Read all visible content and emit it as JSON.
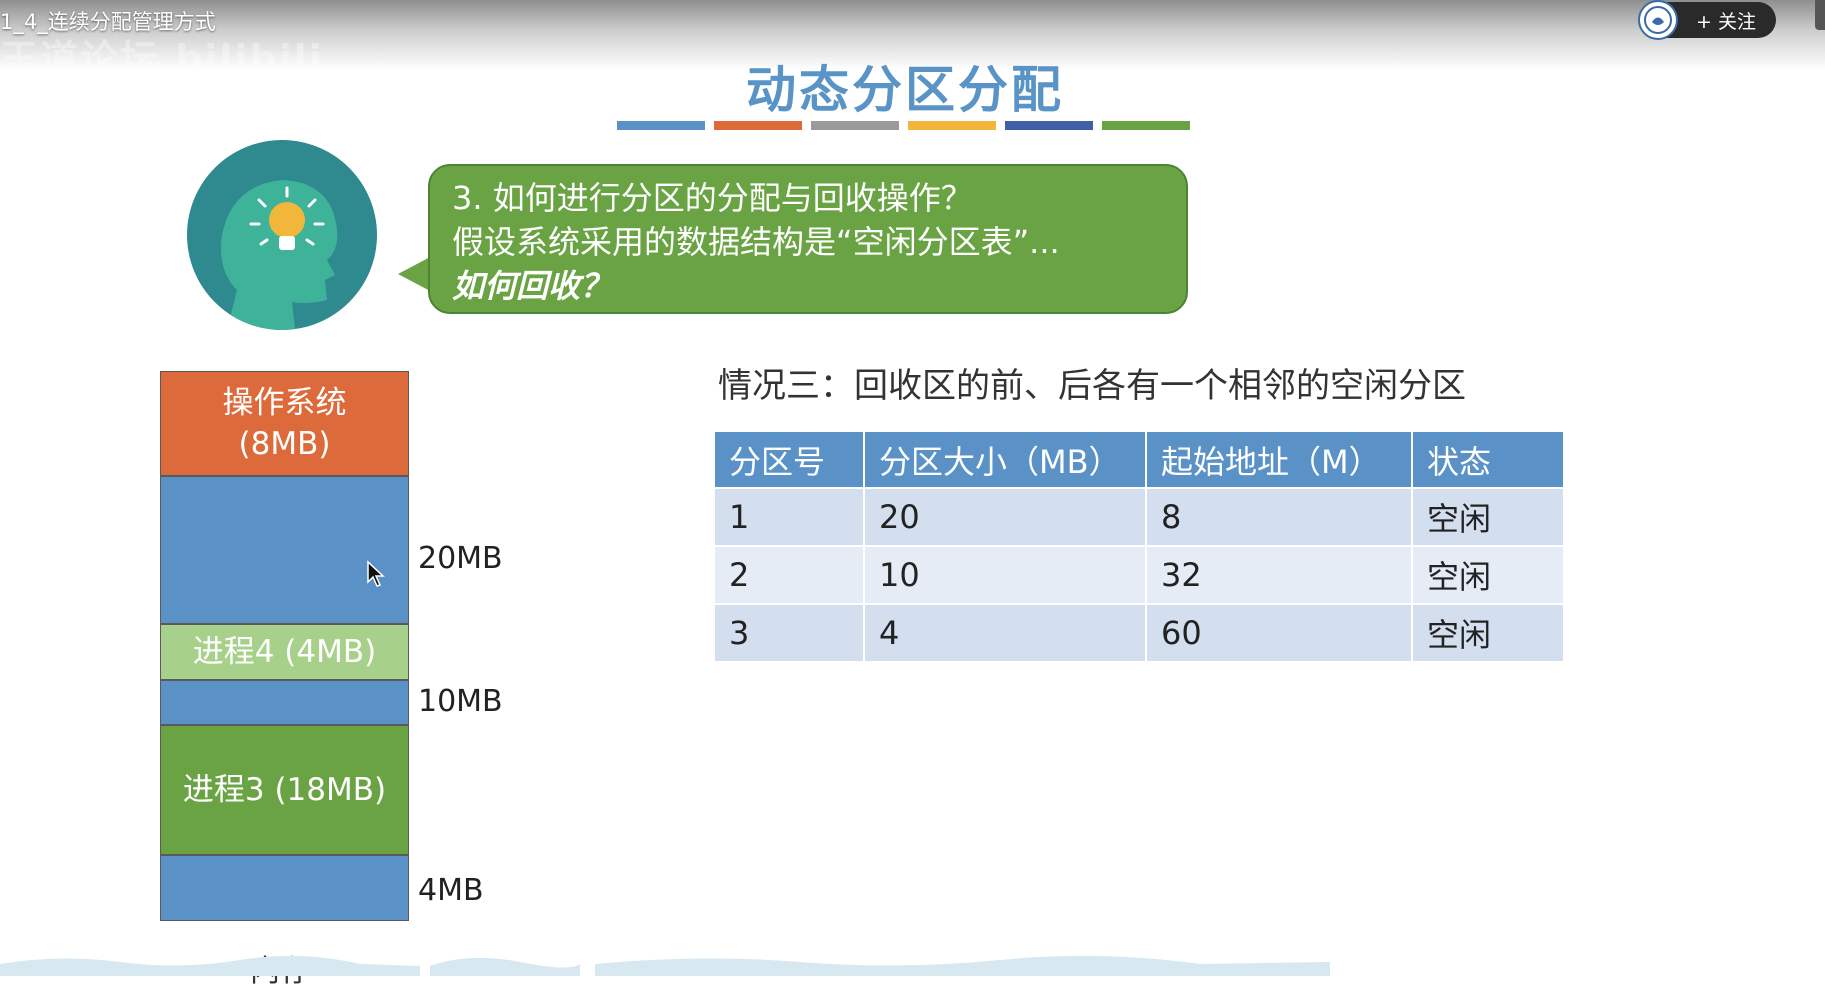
{
  "video": {
    "title": "1_4_连续分配管理方式",
    "watermark": "王道论坛 bilibili",
    "follow_label": "+ 关注"
  },
  "slide": {
    "title": "动态分区分配",
    "title_bar_colors": [
      "#5a92c8",
      "#dd6a3b",
      "#9a9a9a",
      "#f2b63a",
      "#3f5fa8",
      "#6aa343"
    ],
    "bubble": {
      "line1": "3. 如何进行分区的分配与回收操作？",
      "line2": "假设系统采用的数据结构是“空闲分区表”...",
      "line3": "如何回收？"
    },
    "memory": {
      "os_label": "操作系统",
      "os_size": "(8MB)",
      "p4_label": "进程4 (4MB)",
      "p3_label": "进程3 (18MB)",
      "size_20": "20MB",
      "size_10": "10MB",
      "size_4": "4MB",
      "caption": "内存"
    },
    "case_heading": "情况三：回收区的前、后各有一个相邻的空闲分区",
    "table": {
      "headers": [
        "分区号",
        "分区大小（MB）",
        "起始地址（M）",
        "状态"
      ],
      "rows": [
        [
          "1",
          "20",
          "8",
          "空闲"
        ],
        [
          "2",
          "10",
          "32",
          "空闲"
        ],
        [
          "3",
          "4",
          "60",
          "空闲"
        ]
      ]
    }
  }
}
